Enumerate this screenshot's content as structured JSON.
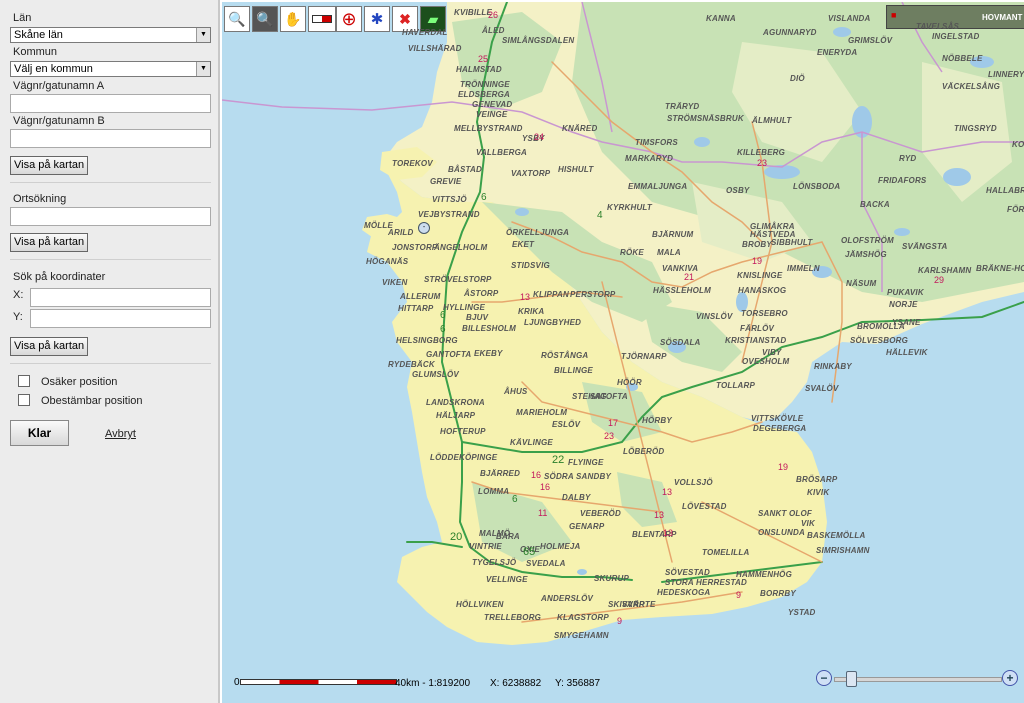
{
  "sidebar": {
    "lan_label": "Län",
    "lan_value": "Skåne län",
    "kommun_label": "Kommun",
    "kommun_value": "Välj en kommun",
    "road_a_label": "Vägnr/gatunamn A",
    "road_b_label": "Vägnr/gatunamn B",
    "show_button_1": "Visa på kartan",
    "place_search_label": "Ortsökning",
    "show_button_2": "Visa på kartan",
    "coord_search_label": "Sök på koordinater",
    "x_label": "X:",
    "y_label": "Y:",
    "show_button_3": "Visa på kartan",
    "uncertain_label": "Osäker position",
    "undeterminable_label": "Obestämbar position",
    "done_button": "Klar",
    "cancel_link": "Avbryt"
  },
  "toolbar": {
    "tools": [
      "zoom-in-icon",
      "zoom-out-icon",
      "pan-hand-icon",
      "measure-icon",
      "target-icon",
      "position-icon",
      "clear-icon",
      "layers-icon"
    ]
  },
  "map": {
    "scale_zero": "0",
    "scale_text": "40km - 1:819200",
    "x_coord": "X: 6238882",
    "y_coord": "Y: 356887",
    "overview_label": "HOVMANT",
    "places": [
      "KVIBILLE",
      "ÅLED",
      "HAVERDAL",
      "SIMLÅNGSDALEN",
      "KANNA",
      "VISLANDA",
      "AGUNNARYD",
      "GRIMSLÖV",
      "TAVELSÅS",
      "INGELSTAD",
      "VILLSHÄRAD",
      "HALMSTAD",
      "ENERYDA",
      "NÖBBELE",
      "LINNERYD",
      "TRÖNNINGE",
      "ELDSBERGA",
      "GENEVAD",
      "VEINGE",
      "DIÖ",
      "VÄCKELSÅNG",
      "TRÄRYD",
      "STRÖMSNÄSBRUK",
      "ÄLMHULT",
      "MELLBYSTRAND",
      "YSBY",
      "KNÄRED",
      "TINGSRYD",
      "VALLBERGA",
      "TIMSFORS",
      "MARKARYD",
      "KILLEBERG",
      "KONGA",
      "TOREKOV",
      "BÅSTAD",
      "HISHULT",
      "RYD",
      "GREVIE",
      "VAXTORP",
      "EMMALJUNGA",
      "OSBY",
      "LÖNSBODA",
      "FRIDAFORS",
      "HALLABRO",
      "FÖRSLÖV",
      "VITTSJÖ",
      "KYRKHULT",
      "BACKA",
      "VEJBYSTRAND",
      "GLIMÅKRA",
      "MÖLLE",
      "ÖRKELLJUNGA",
      "HÄSTVEDA",
      "ARILD",
      "BJÄRNUM",
      "BROBY",
      "SIBBHULT",
      "OLOFSTRÖM",
      "JONSTORP",
      "ÄNGELHOLM",
      "EKET",
      "RÖKE",
      "MALA",
      "SVÄNGSTA",
      "HÖGANÄS",
      "JÄMSHÖG",
      "IMMELN",
      "KARLSHAMN",
      "BRÄKNE-HO",
      "STIDSVIG",
      "VANKIVA",
      "KNISLINGE",
      "VIKEN",
      "STRÖVELSTORP",
      "HÄSSLEHOLM",
      "HANASKOG",
      "NÄSUM",
      "PUKAVIK",
      "ALLERUM",
      "ÅSTORP",
      "KLIPPAN",
      "PERSTORP",
      "NORJE",
      "HITTARP",
      "HYLLINGE",
      "KRIKA",
      "VINSLÖV",
      "TORSEBRO",
      "BROMÖLLA",
      "BJUV",
      "LJUNGBYHED",
      "FÄRLÖV",
      "YSANE",
      "BILLESHOLM",
      "KRISTIANSTAD",
      "SÖLVESBORG",
      "HELSINGBORG",
      "EKEBY",
      "SÖSDALA",
      "VIBY",
      "HÄLLEVIK",
      "GANTOFTA",
      "RÖSTÅNGA",
      "TJÖRNARP",
      "OVESHOLM",
      "RYDEBÄCK",
      "RINKABY",
      "GLUMSLÖV",
      "BILLINGE",
      "HÖÖR",
      "TOLLARP",
      "SVALÖV",
      "ÅHUS",
      "LANDSKRONA",
      "STEHAG",
      "SATOFTA",
      "HÄLJARP",
      "MARIEHOLM",
      "VITTSKÖVLE",
      "ESLÖV",
      "HÖRBY",
      "DEGEBERGA",
      "HOFTERUP",
      "KÄVLINGE",
      "LÖDDEKÖPINGE",
      "FLYINGE",
      "LÖBERÖD",
      "BJÄRRED",
      "SÖDRA SANDBY",
      "VOLLSJÖ",
      "BRÖSARP",
      "LOMMA",
      "DALBY",
      "KIVIK",
      "LÖVESTAD",
      "SANKT OLOF",
      "VEBERÖD",
      "VIK",
      "MALMÖ",
      "GENARP",
      "BLENTARP",
      "ONSLUNDA",
      "BASKEMÖLLA",
      "BARA",
      "OXIE",
      "HOLMEJA",
      "TOMELILLA",
      "SIMRISHAMN",
      "VINTRIE",
      "TYGELSJÖ",
      "SVEDALA",
      "SÖVESTAD",
      "VELLINGE",
      "SKURUP",
      "HAMMENHÖG",
      "STORA HERRESTAD",
      "HEDESKOGA",
      "BORRBY",
      "ANDERSLÖV",
      "HÖLLVIKEN",
      "YSTAD",
      "SVÄRTE",
      "KLAGSTORP",
      "TRELLEBORG",
      "SKIVARP",
      "SMYGEHAMN"
    ]
  }
}
